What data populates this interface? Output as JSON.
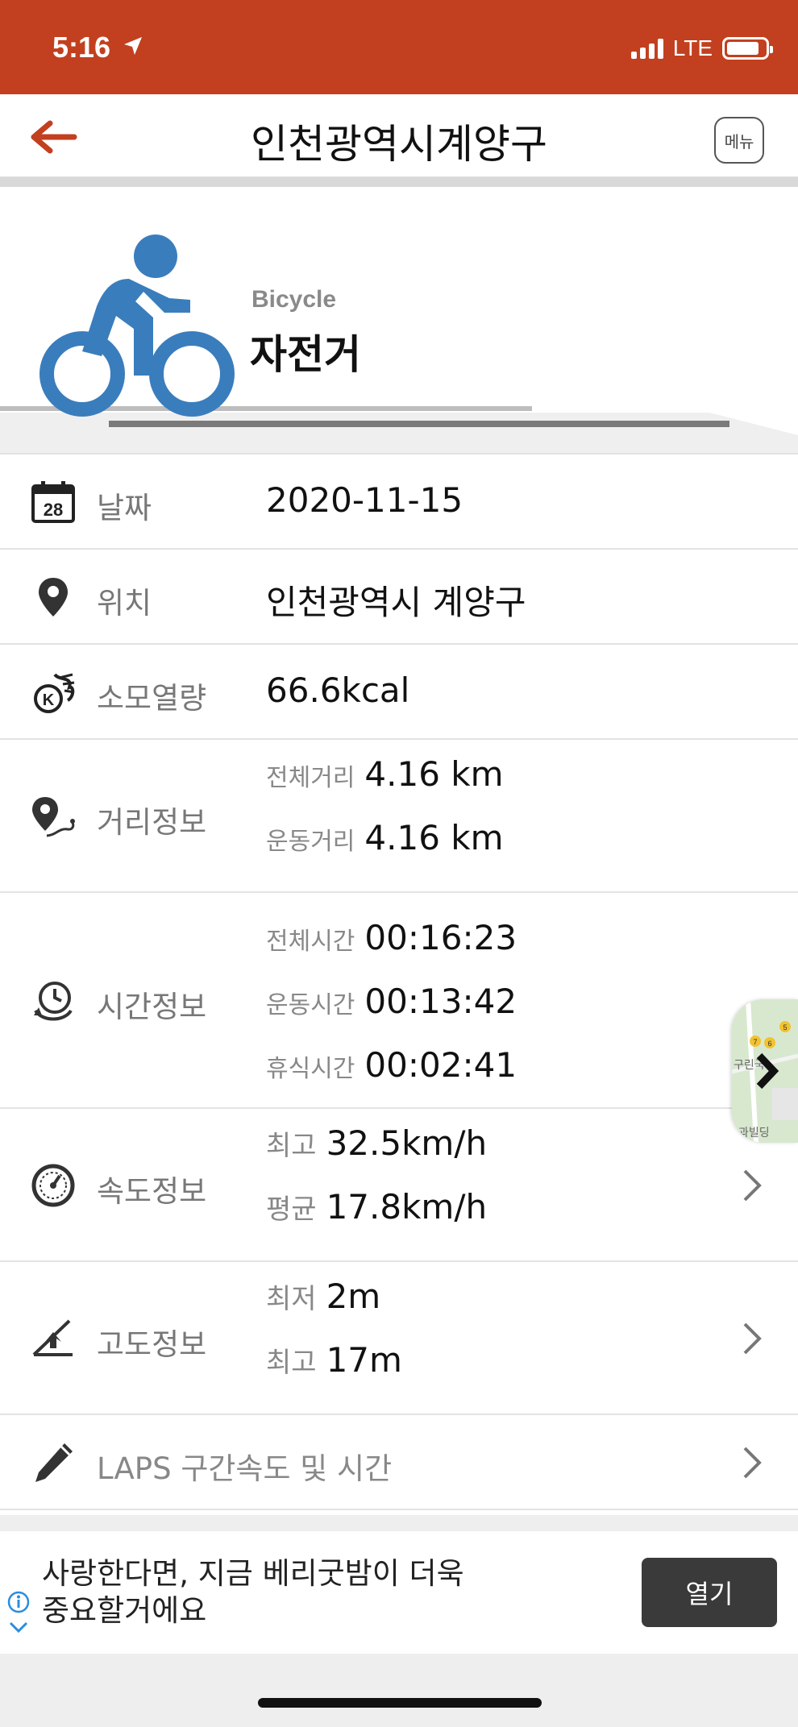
{
  "colors": {
    "brand": "#c2401f",
    "icon_blue": "#3a7dbd"
  },
  "status_bar": {
    "time": "5:16",
    "network": "LTE",
    "battery_level": 0.85
  },
  "nav": {
    "title": "인천광역시계양구",
    "menu_label": "메뉴",
    "back_icon": "arrow-left-icon"
  },
  "activity": {
    "sport_en": "Bicycle",
    "sport_ko": "자전거",
    "icon": "bicycle-icon"
  },
  "rows": {
    "date": {
      "label": "날짜",
      "value": "2020-11-15",
      "icon": "calendar-icon",
      "icon_text": "28"
    },
    "location": {
      "label": "위치",
      "value": "인천광역시 계양구",
      "icon": "location-pin-icon"
    },
    "calories": {
      "label": "소모열량",
      "value": "66.6kcal",
      "icon": "calorie-flame-icon",
      "icon_text": "K"
    },
    "distance": {
      "label": "거리정보",
      "icon": "distance-route-icon",
      "total_label": "전체거리",
      "total_value": "4.16 km",
      "exercise_label": "운동거리",
      "exercise_value": "4.16 km"
    },
    "time": {
      "label": "시간정보",
      "icon": "clock-icon",
      "total_label": "전체시간",
      "total_value": "00:16:23",
      "exercise_label": "운동시간",
      "exercise_value": "00:13:42",
      "rest_label": "휴식시간",
      "rest_value": "00:02:41"
    },
    "speed": {
      "label": "속도정보",
      "icon": "speedometer-icon",
      "max_label": "최고",
      "max_value": "32.5km/h",
      "avg_label": "평균",
      "avg_value": "17.8km/h"
    },
    "altitude": {
      "label": "고도정보",
      "icon": "altitude-icon",
      "min_label": "최저",
      "min_value": "2m",
      "max_label": "최고",
      "max_value": "17m"
    },
    "laps": {
      "label": "LAPS 구간속도 및 시간",
      "icon": "pencil-icon"
    }
  },
  "map_thumb": {
    "icon": "map-thumbnail-icon",
    "marker_labels": [
      "5",
      "7",
      "6"
    ],
    "visible_fragments": [
      "구린국",
      "과빌딩"
    ]
  },
  "ad": {
    "line1": "사랑한다면, 지금 베리굿밤이 더욱",
    "line2": "중요할거에요",
    "button_label": "열기",
    "info_icon": "info-icon"
  }
}
